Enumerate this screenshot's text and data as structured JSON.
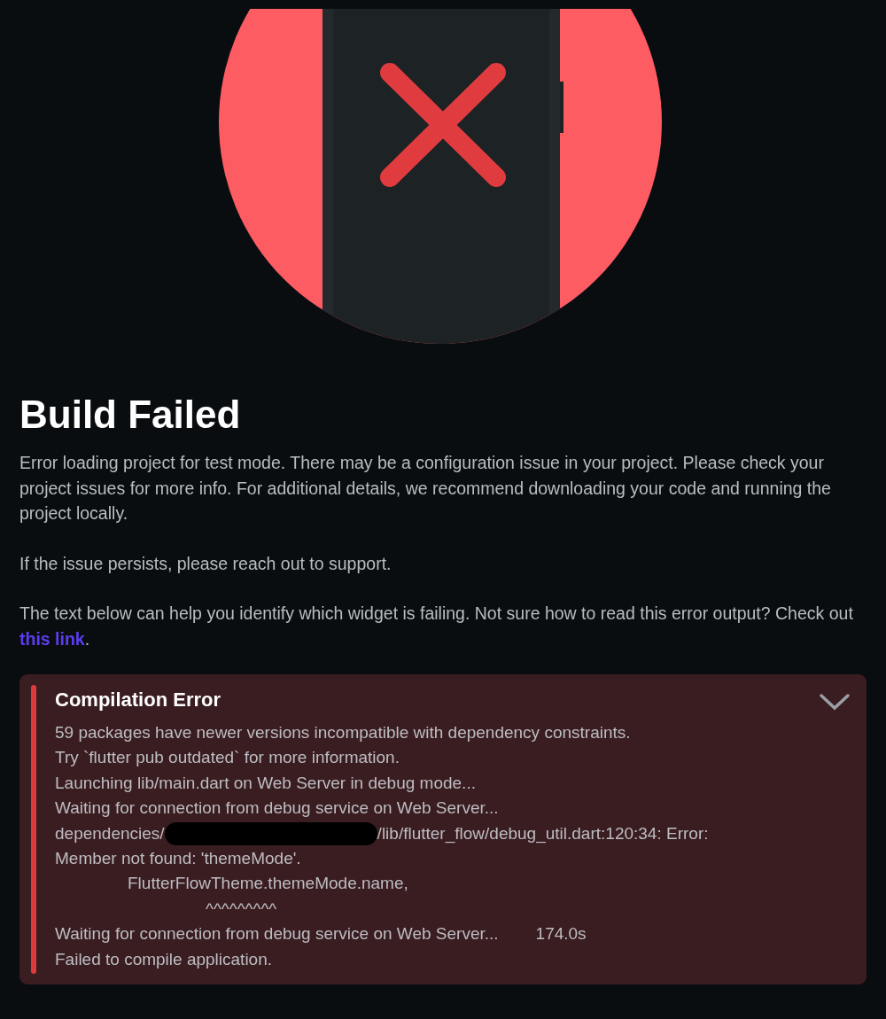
{
  "title": "Build Failed",
  "paragraphs": [
    {
      "text": "Error loading project for test mode. There may be a configuration issue in your project. Please check your project issues for more info. For additional details, we recommend downloading your code and running the project locally."
    },
    {
      "text": "If the issue persists, please reach out to support."
    },
    {
      "text": "The text below can help you identify which widget is failing. Not sure how to read this error output? Check out ",
      "link": "this link",
      "after": "."
    }
  ],
  "error_panel": {
    "title": "Compilation Error",
    "lines": [
      {
        "kind": "plain",
        "text": "59 packages have newer versions incompatible with dependency constraints."
      },
      {
        "kind": "plain",
        "text": "Try `flutter pub outdated` for more information."
      },
      {
        "kind": "plain",
        "text": "Launching lib/main.dart on Web Server in debug mode..."
      },
      {
        "kind": "plain",
        "text": "Waiting for connection from debug service on Web Server..."
      },
      {
        "kind": "redacted",
        "before": "dependencies/",
        "after": "/lib/flutter_flow/debug_util.dart:120:34: Error:"
      },
      {
        "kind": "plain",
        "text": "Member not found: 'themeMode'."
      },
      {
        "kind": "indented",
        "text": "FlutterFlowTheme.themeMode.name,"
      },
      {
        "kind": "caret",
        "text": "^^^^^^^^^"
      },
      {
        "kind": "timed",
        "text": "Waiting for connection from debug service on Web Server...",
        "time": "174.0s"
      },
      {
        "kind": "plain",
        "text": "Failed to compile application."
      }
    ]
  }
}
